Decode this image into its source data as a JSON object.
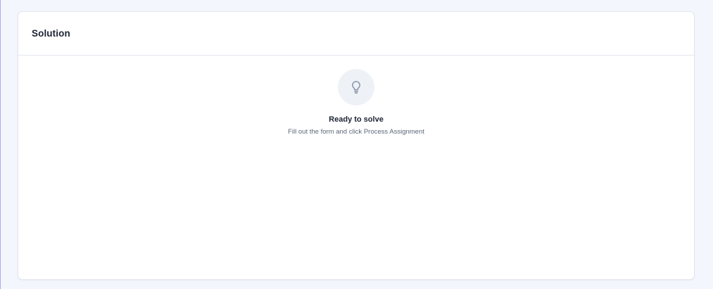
{
  "panel": {
    "title": "Solution"
  },
  "empty_state": {
    "icon": "lightbulb-icon",
    "title": "Ready to solve",
    "subtitle": "Fill out the form and click Process Assignment"
  },
  "colors": {
    "page_background": "#f4f6fd",
    "card_background": "#ffffff",
    "icon_circle": "#eef2f7",
    "icon_stroke": "#8d97ab",
    "title_text": "#1c2333",
    "subtitle_text": "#5d6678"
  }
}
